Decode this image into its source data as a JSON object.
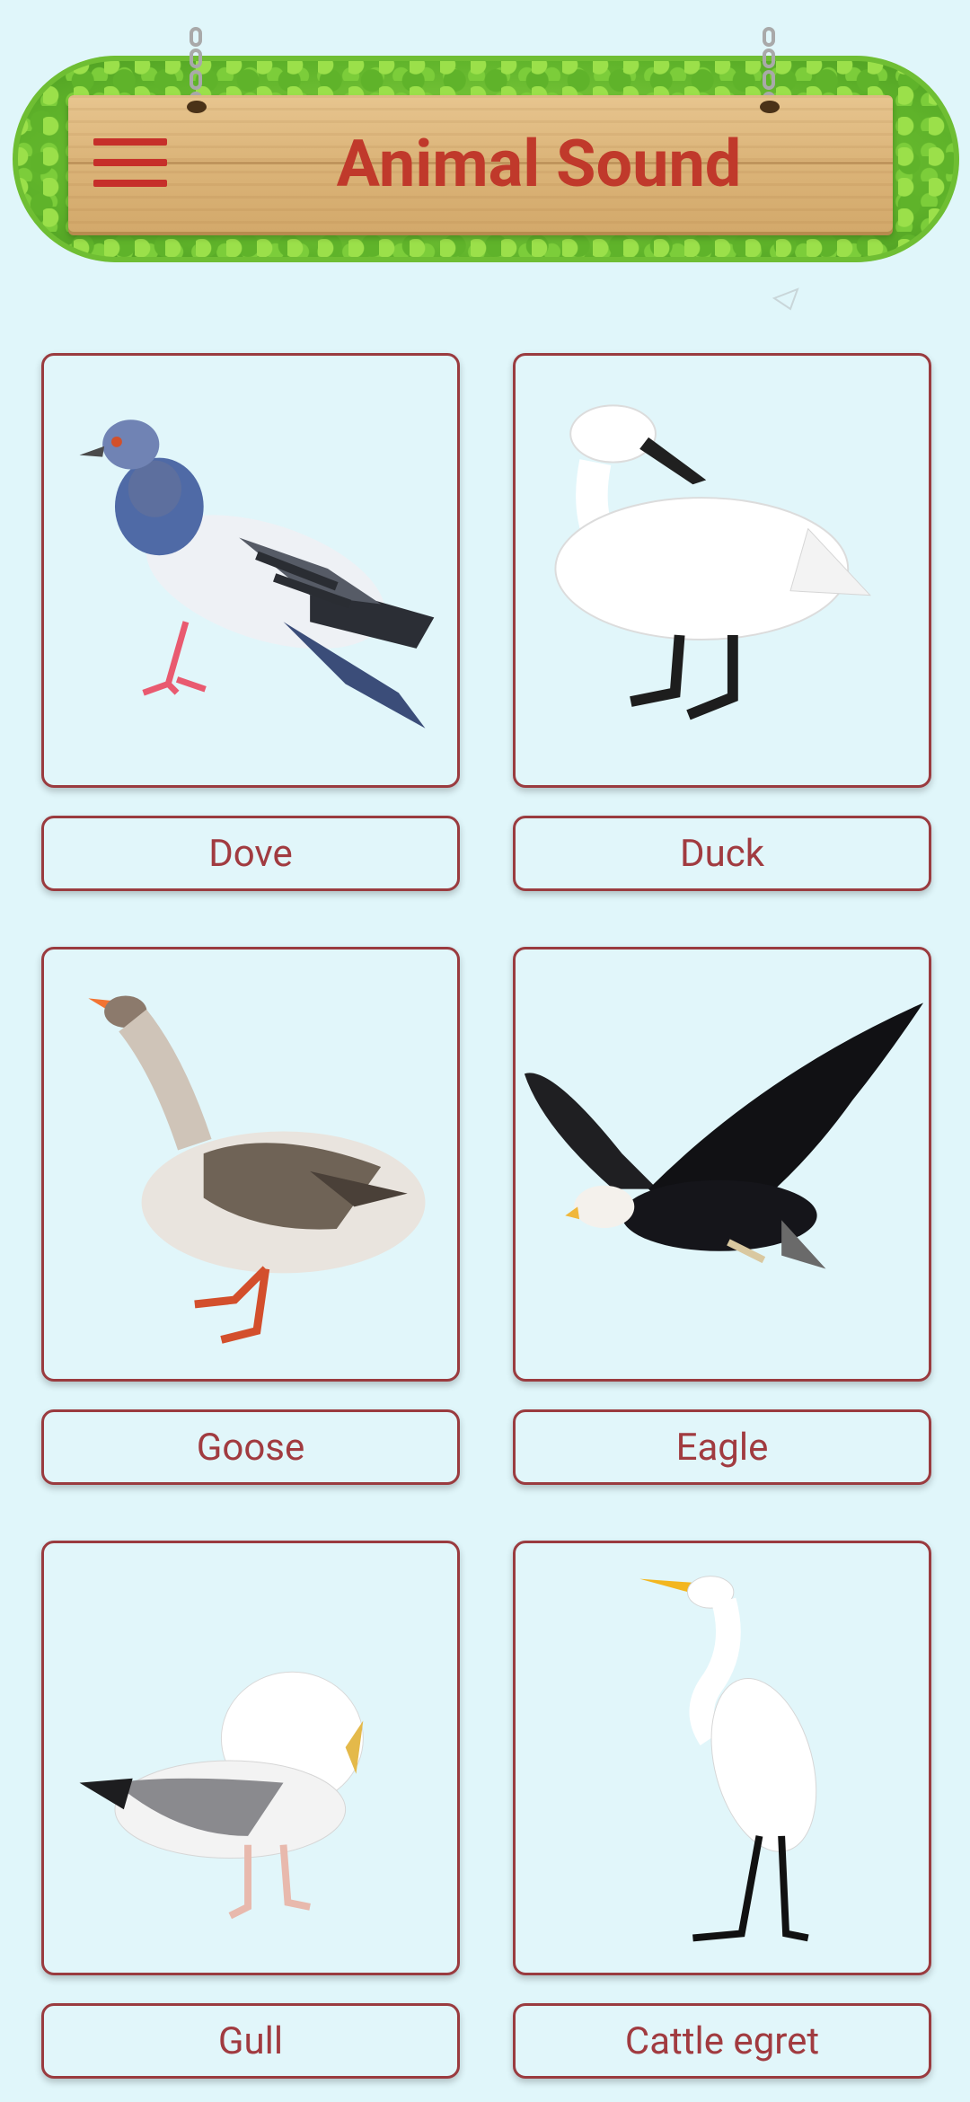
{
  "header": {
    "title": "Animal Sound"
  },
  "animals": [
    {
      "name": "Dove"
    },
    {
      "name": "Duck"
    },
    {
      "name": "Goose"
    },
    {
      "name": "Eagle"
    },
    {
      "name": "Gull"
    },
    {
      "name": "Cattle egret"
    }
  ],
  "colors": {
    "background": "#e0f6fa",
    "accent": "#c0392b",
    "card_border": "#9a3b3f",
    "label_text": "#a13b40"
  }
}
